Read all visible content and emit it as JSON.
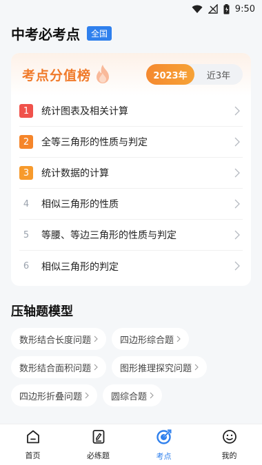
{
  "status_bar": {
    "time": "9:50"
  },
  "header": {
    "title": "中考必考点",
    "region_badge": "全国"
  },
  "ranking": {
    "title": "考点分值榜",
    "tabs": [
      "2023年",
      "近3年"
    ],
    "active_tab": "2023年",
    "items": [
      {
        "rank": "1",
        "label": "统计图表及相关计算",
        "badge_color": "#f0524b"
      },
      {
        "rank": "2",
        "label": "全等三角形的性质与判定",
        "badge_color": "#f5852a"
      },
      {
        "rank": "3",
        "label": "统计数据的计算",
        "badge_color": "#f79a2c"
      },
      {
        "rank": "4",
        "label": "相似三角形的性质",
        "badge_color": ""
      },
      {
        "rank": "5",
        "label": "等腰、等边三角形的性质与判定",
        "badge_color": ""
      },
      {
        "rank": "6",
        "label": "相似三角形的判定",
        "badge_color": ""
      }
    ]
  },
  "models": {
    "title": "压轴题模型",
    "tags": [
      "数形结合长度问题",
      "四边形综合题",
      "数形结合面积问题",
      "图形推理探究问题",
      "四边形折叠问题",
      "圆综合题"
    ]
  },
  "bottom_nav": {
    "items": [
      {
        "label": "首页",
        "icon": "home-icon"
      },
      {
        "label": "必练题",
        "icon": "exercise-icon"
      },
      {
        "label": "考点",
        "icon": "exam-point-icon"
      },
      {
        "label": "我的",
        "icon": "profile-icon"
      }
    ],
    "active": "考点",
    "accent": "#2f80ed"
  }
}
